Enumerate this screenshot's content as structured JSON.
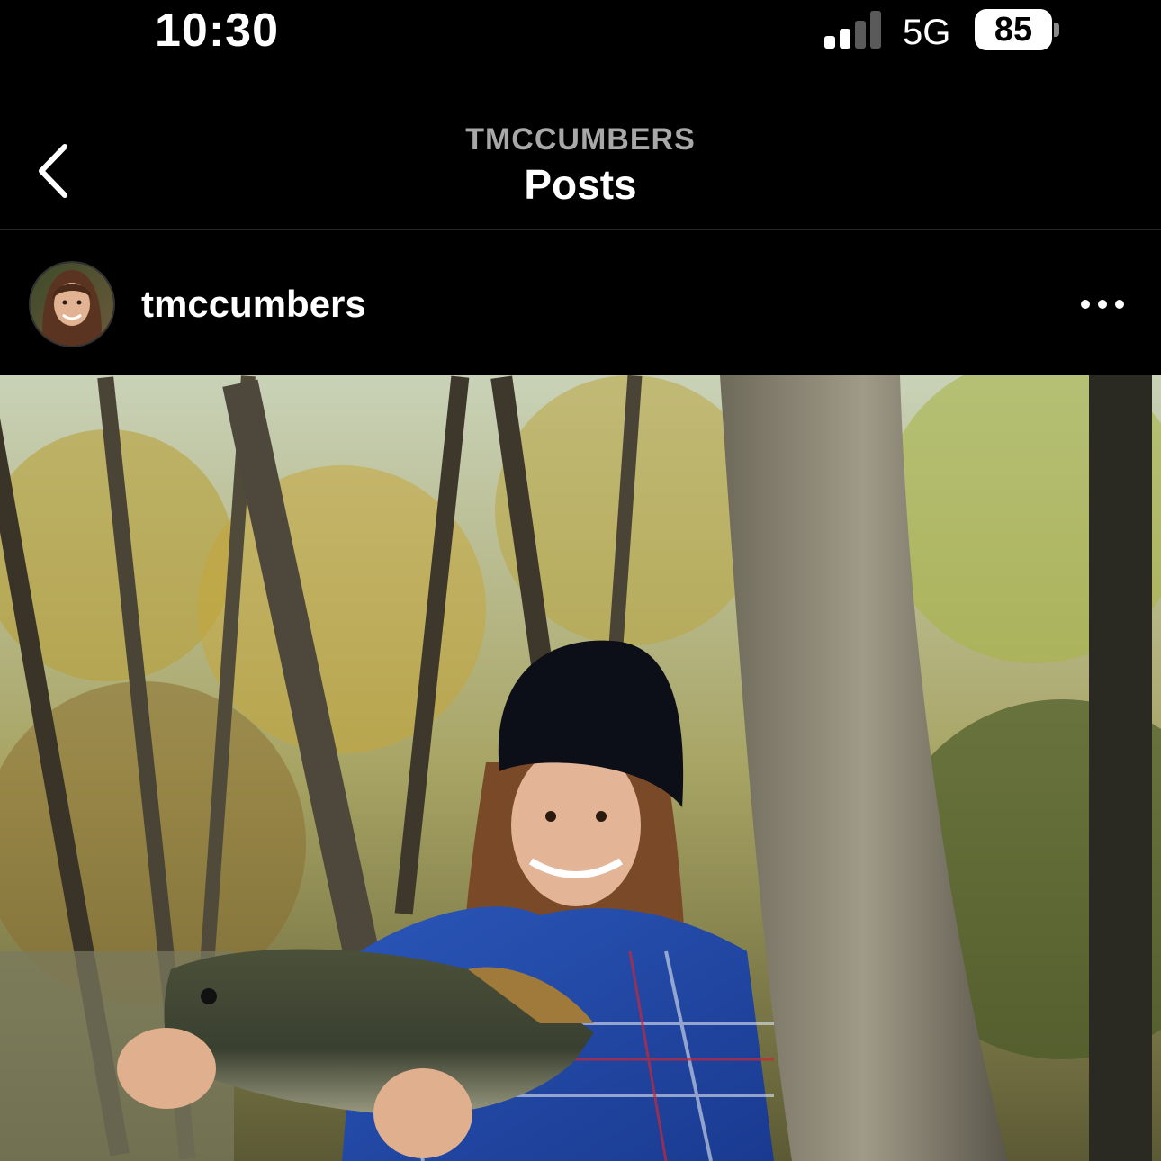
{
  "status_bar": {
    "time": "10:30",
    "network": "5G",
    "battery": "85",
    "signal_icon": "cellular-signal-icon",
    "battery_icon": "battery-icon"
  },
  "nav": {
    "subtitle": "TMCCUMBERS",
    "title": "Posts",
    "back_icon": "chevron-left-icon"
  },
  "post": {
    "username": "tmccumbers",
    "more_icon": "more-horizontal-icon",
    "photo_description_icon": "photo"
  },
  "colors": {
    "background": "#000000",
    "text_primary": "#ffffff",
    "text_secondary": "#a8a8a8",
    "divider": "#262626"
  }
}
